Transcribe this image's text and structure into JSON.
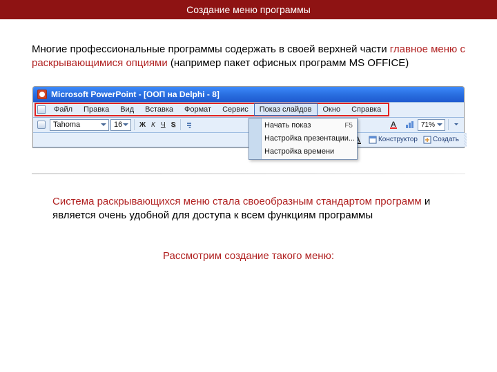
{
  "header": {
    "title": "Создание меню программы"
  },
  "para1": {
    "text1": "Многие профессиональные программы содержать в своей верхней части ",
    "red": "главное меню с раскрывающимися опциями",
    "text2": " (например пакет офисных программ MS OFFICE)"
  },
  "window": {
    "title": "Microsoft PowerPoint - [ООП на Delphi - 8]",
    "menubar": {
      "items": [
        {
          "label": "Файл"
        },
        {
          "label": "Правка"
        },
        {
          "label": "Вид"
        },
        {
          "label": "Вставка"
        },
        {
          "label": "Формат"
        },
        {
          "label": "Сервис"
        },
        {
          "label": "Показ слайдов",
          "open": true
        },
        {
          "label": "Окно"
        },
        {
          "label": "Справка"
        }
      ],
      "dropdown": [
        {
          "label": "Начать показ",
          "shortcut": "F5"
        },
        {
          "label": "Настройка презентации..."
        },
        {
          "label": "Настройка времени"
        }
      ]
    },
    "toolbar": {
      "font": "Tahoma",
      "size": "16",
      "bold": "Ж",
      "italic": "К",
      "underline": "Ч",
      "shadow": "S",
      "zoom": "71%",
      "designer_label": "Конструктор",
      "new_slide_label": "Создать"
    }
  },
  "para2": {
    "red": "Система раскрывающихся меню стала своеобразным стандартом программ",
    "rest": " и является очень удобной для доступа к всем функциям программы"
  },
  "para3": {
    "text": "Рассмотрим создание такого меню:"
  }
}
